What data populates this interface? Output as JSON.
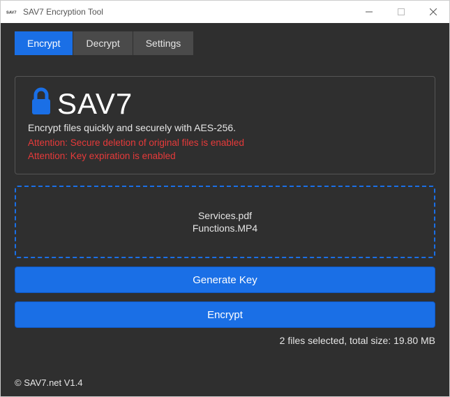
{
  "window": {
    "title": "SAV7 Encryption Tool",
    "icon_text": "SAV7"
  },
  "tabs": [
    {
      "label": "Encrypt",
      "active": true
    },
    {
      "label": "Decrypt",
      "active": false
    },
    {
      "label": "Settings",
      "active": false
    }
  ],
  "hero": {
    "brand": "SAV7",
    "subtitle": "Encrypt files quickly and securely with AES-256.",
    "warnings": [
      "Attention: Secure deletion of original files is enabled",
      "Attention: Key expiration is enabled"
    ]
  },
  "dropzone": {
    "files": [
      "Services.pdf",
      "Functions.MP4"
    ]
  },
  "buttons": {
    "generate_key": "Generate Key",
    "encrypt": "Encrypt"
  },
  "status": "2 files selected, total size: 19.80 MB",
  "footer": "© SAV7.net V1.4",
  "colors": {
    "accent": "#1a6fe6",
    "warn": "#e63a3a",
    "bg": "#2f2f2f"
  }
}
